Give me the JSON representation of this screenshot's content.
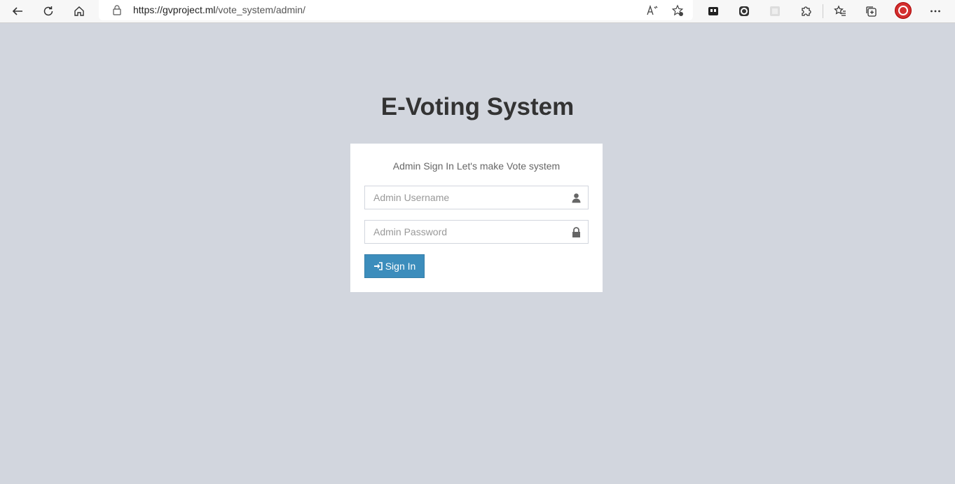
{
  "browser": {
    "url_host": "https://gvproject.ml",
    "url_path": "/vote_system/admin/"
  },
  "login": {
    "title": "E-Voting System",
    "message": "Admin Sign In Let's make Vote system",
    "username_placeholder": "Admin Username",
    "password_placeholder": "Admin Password",
    "signin_label": "Sign In"
  },
  "colors": {
    "page_bg": "#d2d6de",
    "button_bg": "#3c8dbc"
  }
}
